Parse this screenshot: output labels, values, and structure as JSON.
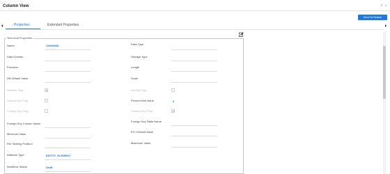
{
  "header": {
    "title": "Column View",
    "controls": "↗ ×"
  },
  "toolbar": {
    "send_review_label": "Send To Review"
  },
  "tabs": [
    {
      "label": "Properties",
      "active": true
    },
    {
      "label": "Extended Properties",
      "active": false
    }
  ],
  "section": {
    "legend": "Technical Properties"
  },
  "left_fields": {
    "name": {
      "label": "Name",
      "value": "CHANNID"
    },
    "data_domain": {
      "label": "Data Domain"
    },
    "precision": {
      "label": "Precision"
    },
    "db_default_value": {
      "label": "DB Default Value"
    },
    "nullable_flag": {
      "label": "Nullable Flag",
      "checked": true
    },
    "natural_key_flag": {
      "label": "Natural Key Flag",
      "checked": false
    },
    "foreign_key_flag": {
      "label": "Foreign Key Flag",
      "checked": false
    },
    "foreign_key_column_name": {
      "label": "Foreign Key Column Name"
    },
    "minimum_value": {
      "label": "Minimum Value"
    },
    "file_starting_position": {
      "label": "File Starting Position"
    },
    "attribute_type": {
      "label": "Attribute Type",
      "value": "ENTITY_ELEMENT"
    },
    "workflow_status": {
      "label": "Workflow Status",
      "value": "Draft"
    }
  },
  "right_fields": {
    "data_type": {
      "label": "Data Type"
    },
    "storage_type": {
      "label": "Storage Type"
    },
    "length": {
      "label": "Length"
    },
    "scale": {
      "label": "Scale"
    },
    "identity_flag": {
      "label": "Identity Flag",
      "checked": false
    },
    "percent_null_value": {
      "label": "Percent Null Value",
      "value": "0"
    },
    "primary_key_flag": {
      "label": "Primary Key Flag",
      "checked": true
    },
    "foreign_key_table_name": {
      "label": "Foreign Key Table Name"
    },
    "etl_default_value": {
      "label": "ETL Default Value"
    },
    "maximum_value": {
      "label": "Maximum Value"
    }
  },
  "colors": {
    "accent": "#1f7ad9",
    "border": "#c8c8c8",
    "muted": "#b9b9b9"
  },
  "icons": [
    "expand-icon",
    "close-icon",
    "edit-icon",
    "chevron-left-icon",
    "chevron-right-icon"
  ]
}
